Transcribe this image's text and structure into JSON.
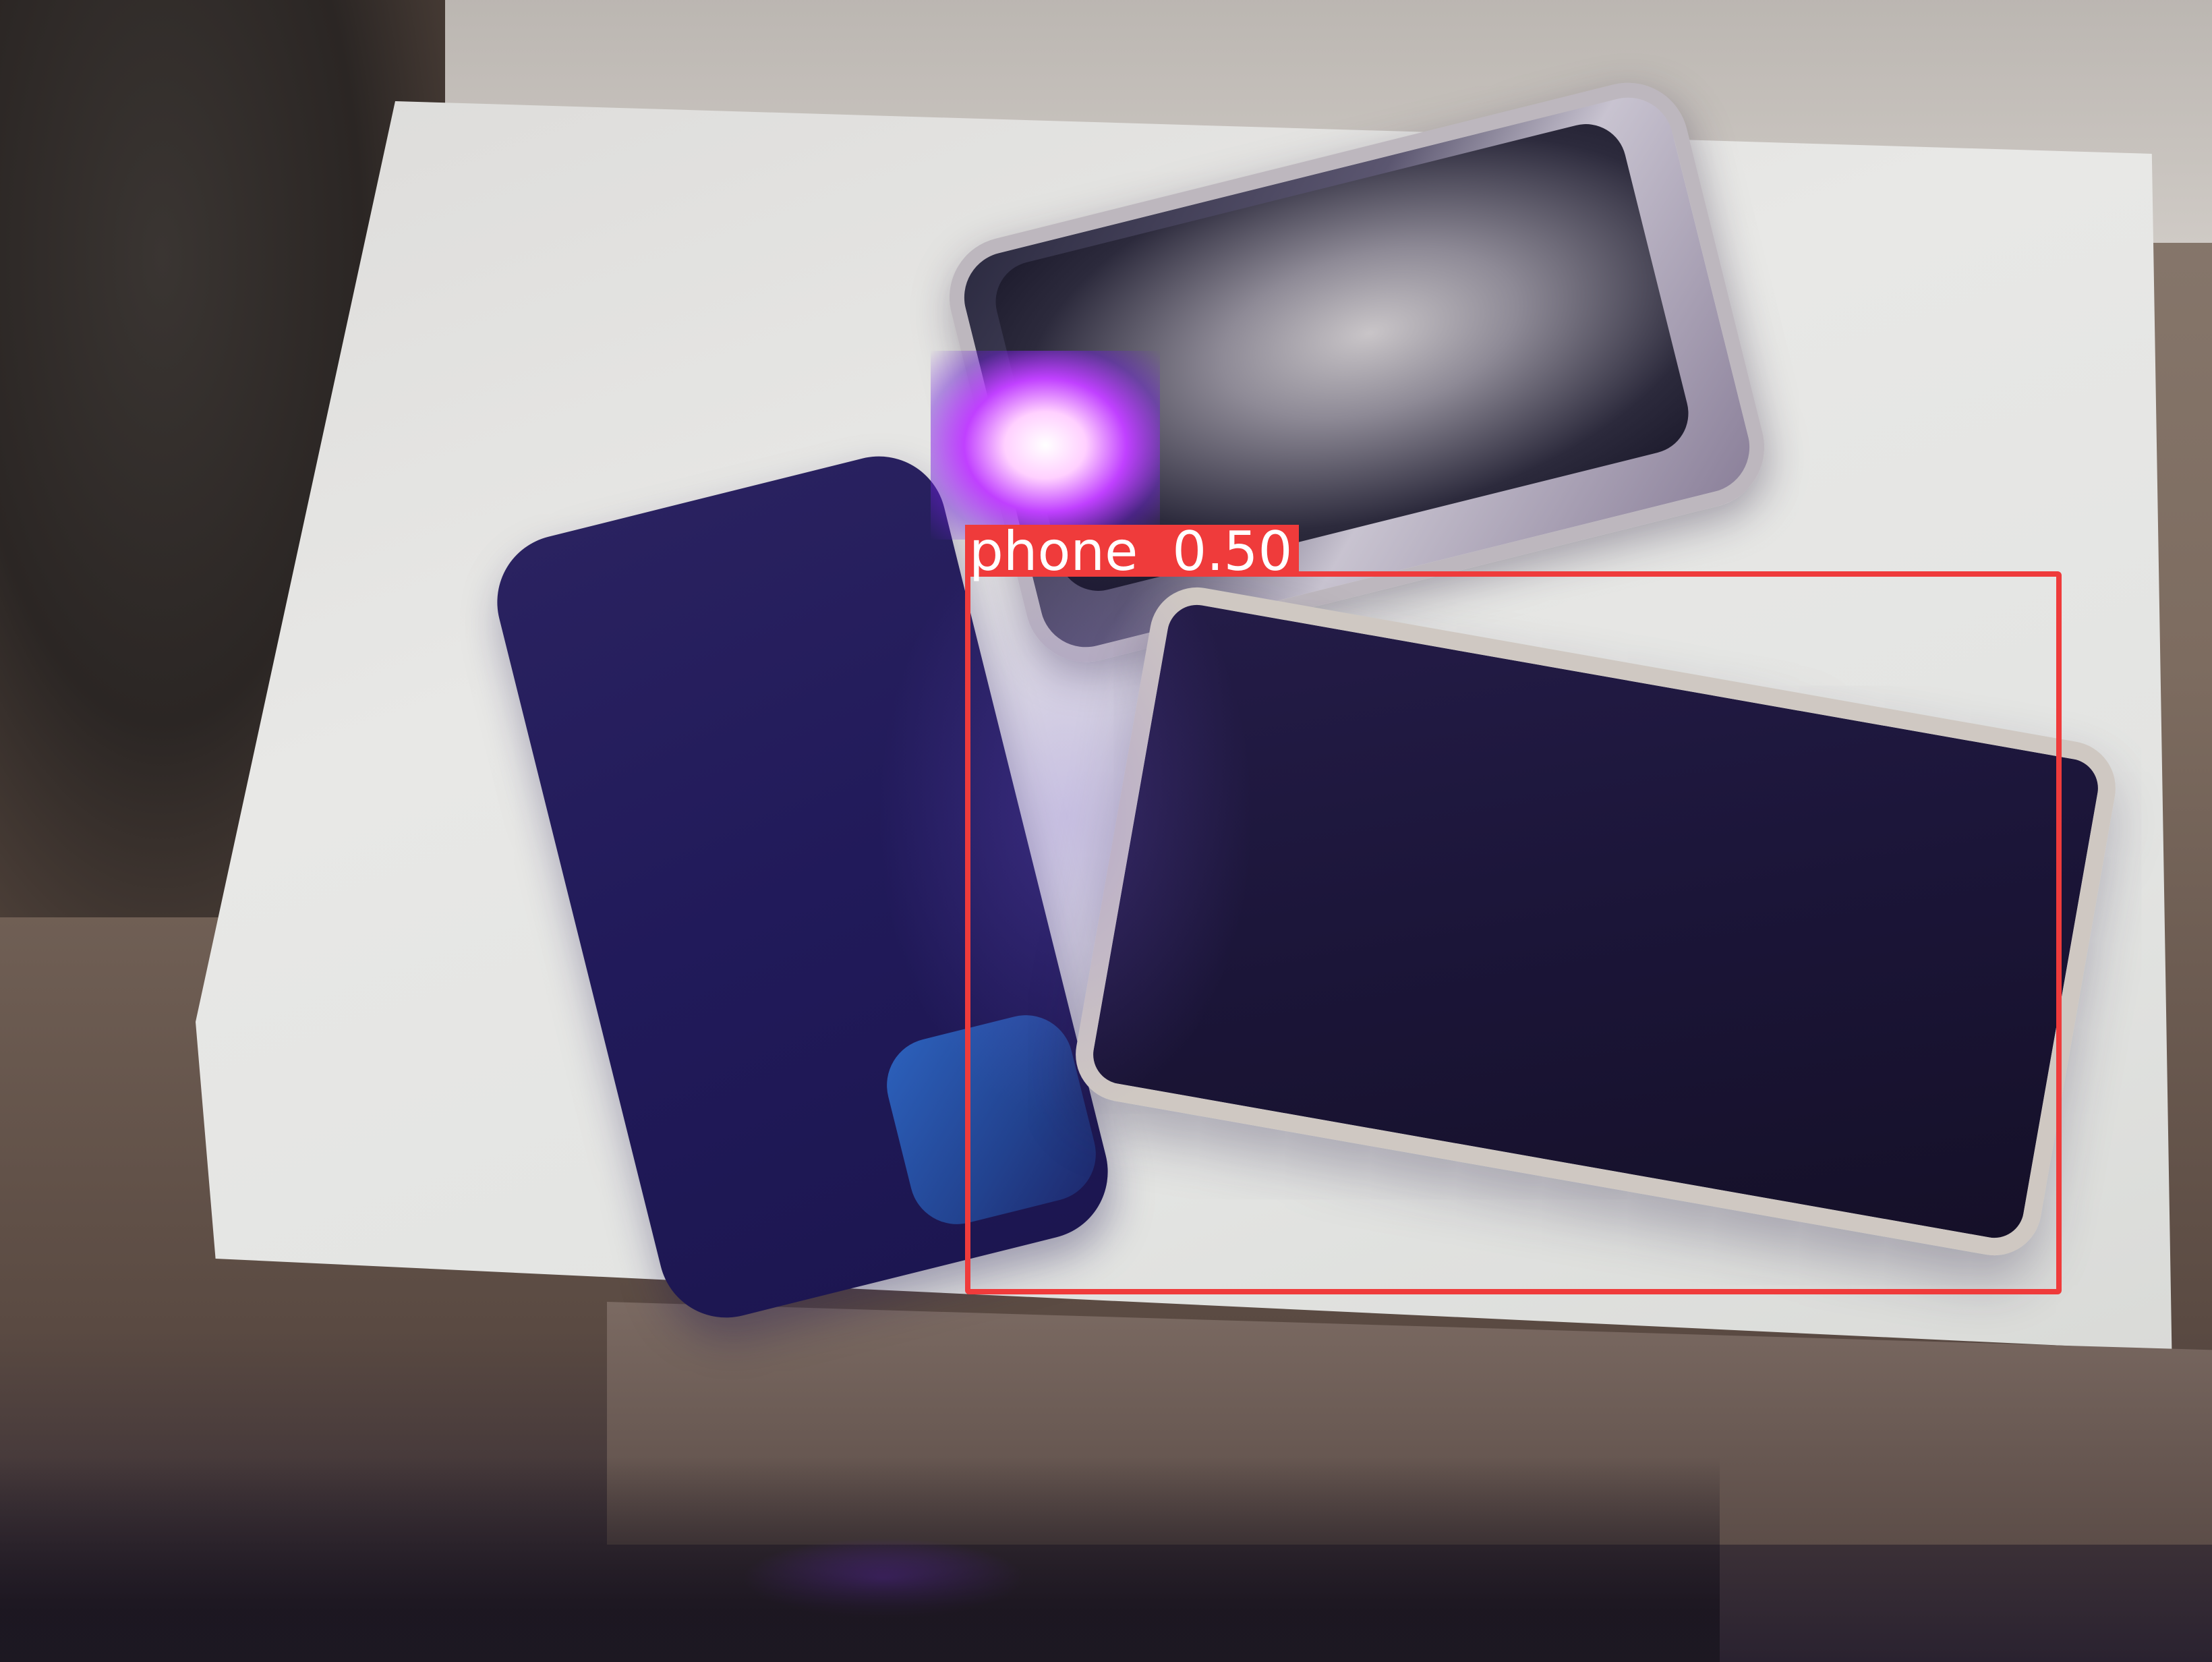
{
  "detection": {
    "label": "phone  0.50",
    "color": "#ef3b3b"
  },
  "scene": {
    "objects": [
      "phone",
      "phone",
      "phone"
    ]
  }
}
